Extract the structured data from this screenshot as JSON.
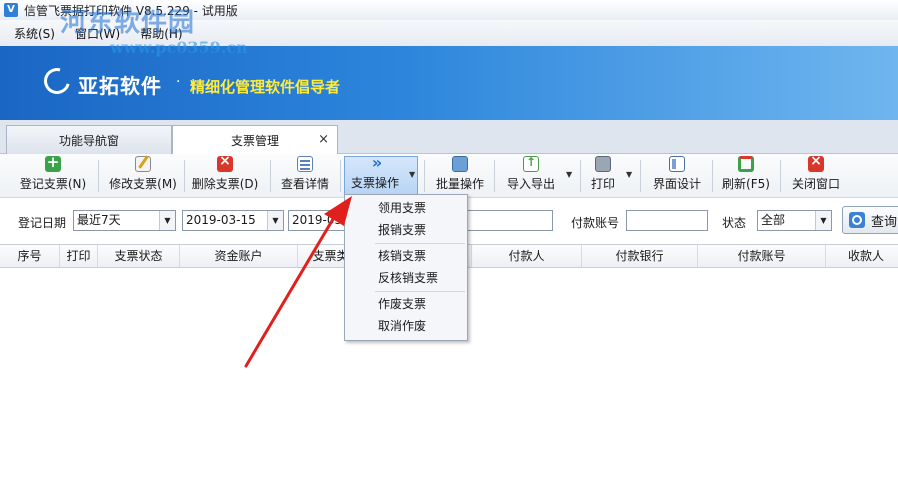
{
  "window": {
    "title": "信管飞票据打印软件 V8.5.229 - 试用版",
    "watermark": "河东软件园",
    "watermark_url": "www.pc0359.cn"
  },
  "menu": {
    "items": [
      "系统(S)",
      "窗口(W)",
      "帮助(H)"
    ]
  },
  "banner": {
    "company": "亚拓软件",
    "dot": "·",
    "slogan": "精细化管理软件倡导者",
    "slogan_color": "#ffeb3b"
  },
  "tabs": [
    {
      "label": "功能导航窗"
    },
    {
      "label": "支票管理",
      "close": "×"
    }
  ],
  "toolbar": {
    "buttons": [
      {
        "label": "登记支票(N)",
        "icon": "add-icon"
      },
      {
        "label": "修改支票(M)",
        "icon": "edit-icon"
      },
      {
        "label": "删除支票(D)",
        "icon": "delete-icon"
      },
      {
        "label": "查看详情",
        "icon": "detail-icon"
      },
      {
        "label": "支票操作",
        "icon": "double-chevron-icon"
      },
      {
        "label": "批量操作",
        "icon": "batch-icon"
      },
      {
        "label": "导入导出",
        "icon": "import-export-icon"
      },
      {
        "label": "打印",
        "icon": "printer-icon"
      },
      {
        "label": "界面设计",
        "icon": "layout-icon"
      },
      {
        "label": "刷新(F5)",
        "icon": "refresh-icon"
      },
      {
        "label": "关闭窗口",
        "icon": "close-window-icon"
      }
    ],
    "arrow_glyph": "▼"
  },
  "filter": {
    "date_label": "登记日期",
    "date_range_value": "最近7天",
    "date_from": "2019-03-15",
    "date_to": "2019-03-",
    "account_label": "付款账号",
    "account_value": "",
    "status_label": "状态",
    "status_value": "全部",
    "query_label": "查询"
  },
  "table": {
    "columns": [
      "序号",
      "打印",
      "支票状态",
      "资金账户",
      "支票类",
      "",
      "付款人",
      "付款银行",
      "付款账号",
      "收款人"
    ],
    "rows": []
  },
  "dropdown": {
    "items": [
      "领用支票",
      "报销支票",
      "核销支票",
      "反核销支票",
      "作废支票",
      "取消作废"
    ]
  },
  "annotation": {
    "arrow_color": "#e0201c"
  }
}
